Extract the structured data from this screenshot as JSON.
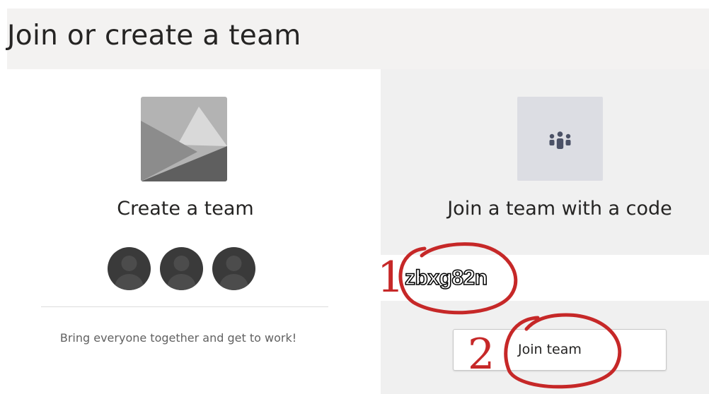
{
  "header": {
    "title": "Join or create a team"
  },
  "create_card": {
    "title": "Create a team",
    "description": "Bring everyone together and get to work!"
  },
  "join_card": {
    "title": "Join a team with a code",
    "code_value": "zbxg82n",
    "join_button_label": "Join team"
  },
  "annotations": {
    "step1": "1",
    "step2": "2"
  },
  "icons": {
    "create_image": "landscape-image-icon",
    "join_icon": "people-group-icon",
    "avatar": "person-silhouette-icon"
  },
  "colors": {
    "annotation_red": "#c62828",
    "avatar_dark": "#3a3a3a",
    "join_panel_bg": "#f0f0f0"
  }
}
